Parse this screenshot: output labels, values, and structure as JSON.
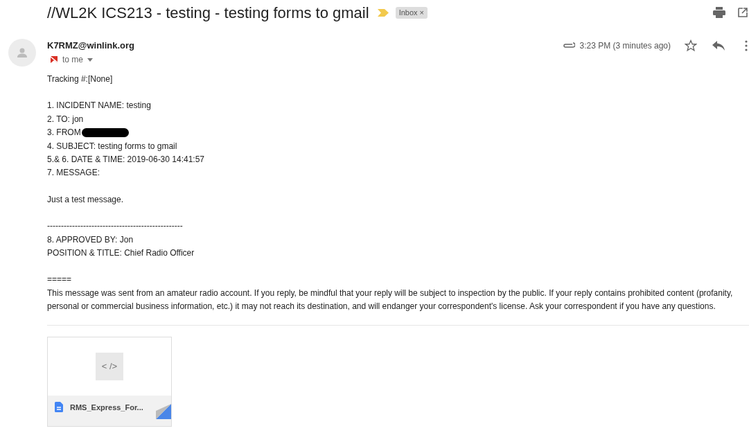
{
  "subject": "//WL2K ICS213 - testing - testing forms to gmail",
  "label": {
    "text": "Inbox",
    "close": "×"
  },
  "sender": "K7RMZ@winlink.org",
  "recipient": "to me",
  "time": "3:23 PM (3 minutes ago)",
  "starred": false,
  "body": [
    {
      "lines": [
        {
          "text": "Tracking #:[None]",
          "kind": "plain"
        }
      ]
    },
    {
      "lines": [
        {
          "text": "1. INCIDENT NAME: testing",
          "kind": "plain"
        },
        {
          "text": "2. TO: jon",
          "kind": "plain"
        },
        {
          "text": "3. FROM",
          "kind": "redacted"
        },
        {
          "text": "4. SUBJECT: testing forms to gmail",
          "kind": "plain"
        },
        {
          "text": "5.& 6. DATE & TIME: 2019-06-30 14:41:57",
          "kind": "plain"
        },
        {
          "text": "7. MESSAGE:",
          "kind": "plain"
        }
      ]
    },
    {
      "lines": [
        {
          "text": "Just a test message.",
          "kind": "plain"
        }
      ]
    },
    {
      "lines": [
        {
          "text": "-------------------------------------------------",
          "kind": "plain"
        },
        {
          "text": "8. APPROVED BY: Jon",
          "kind": "plain"
        },
        {
          "text": "POSITION & TITLE: Chief Radio Officer",
          "kind": "plain"
        }
      ]
    },
    {
      "lines": [
        {
          "text": "=====",
          "kind": "plain"
        },
        {
          "text": "This message was sent from an amateur radio account. If you reply, be mindful that your reply will be subject to inspection by the public. If your reply contains prohibited content (profanity, personal or commercial business information, etc.) it may not reach its destination, and will endanger your correspondent's license. Ask your correspondent if you have any questions.",
          "kind": "plain"
        }
      ]
    }
  ],
  "attachment": {
    "preview": "< />",
    "name": "RMS_Express_For..."
  }
}
